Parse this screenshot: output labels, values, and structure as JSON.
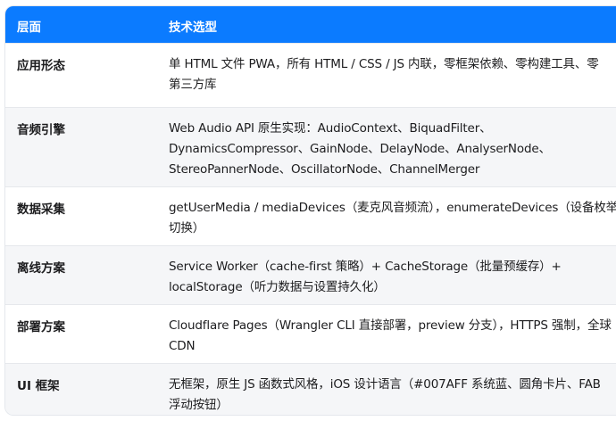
{
  "table": {
    "headers": [
      "层面",
      "技术选型"
    ],
    "rows": [
      {
        "label": "应用形态",
        "lines": [
          "单 HTML 文件 PWA，所有 HTML / CSS / JS 内联，零框架依赖、零构建工具、零",
          "第三方库"
        ]
      },
      {
        "label": "音频引擎",
        "lines": [
          "Web Audio API 原生实现：AudioContext、BiquadFilter、",
          "DynamicsCompressor、GainNode、DelayNode、AnalyserNode、",
          "StereoPannerNode、OscillatorNode、ChannelMerger"
        ]
      },
      {
        "label": "数据采集",
        "lines": [
          "getUserMedia / mediaDevices（麦克风音频流），enumerateDevices（设备枚举与",
          "切换）"
        ]
      },
      {
        "label": "离线方案",
        "lines": [
          "Service Worker（cache-first 策略）+ CacheStorage（批量预缓存）+",
          "localStorage（听力数据与设置持久化）"
        ]
      },
      {
        "label": "部署方案",
        "lines": [
          "Cloudflare Pages（Wrangler CLI 直接部署，preview 分支），HTTPS 强制，全球",
          "CDN"
        ]
      },
      {
        "label": "UI 框架",
        "lines": [
          "无框架，原生 JS 函数式风格，iOS 设计语言（#007AFF 系统蓝、圆角卡片、FAB",
          "浮动按钮）"
        ]
      }
    ]
  },
  "colors": {
    "header_bg": "#0B7BFF",
    "header_text": "#FFFFFF",
    "alt_row_bg": "#F5F6F8",
    "text": "#1C1C1E"
  }
}
